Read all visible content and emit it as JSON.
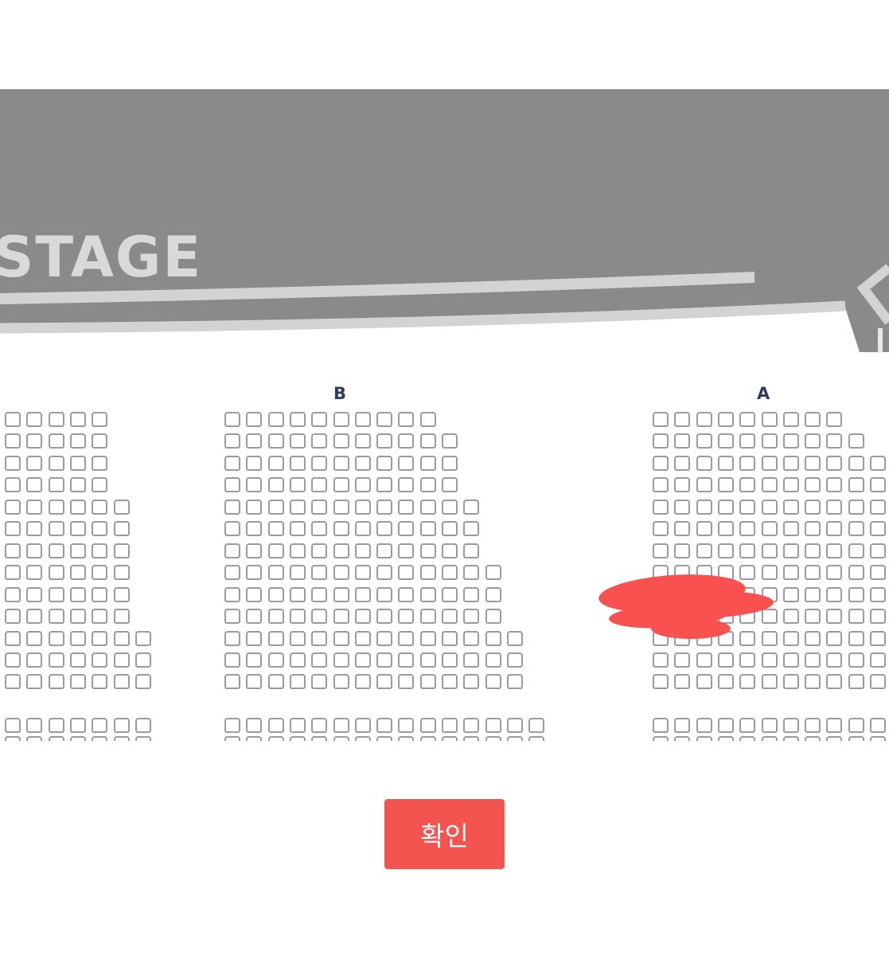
{
  "stage": {
    "label": "STAGE"
  },
  "sections": [
    {
      "id": "A",
      "label": "A"
    },
    {
      "id": "B",
      "label": "B"
    }
  ],
  "actions": {
    "confirm_label": "확인"
  },
  "colors": {
    "stage_fill": "#8a8a8a",
    "stage_rail": "#d3d3d3",
    "stage_label": "#d9d9d9",
    "seat_outline": "#9b9b9b",
    "section_label": "#2f3a5c",
    "redaction": "#f8514f",
    "confirm_button": "#f45450"
  }
}
